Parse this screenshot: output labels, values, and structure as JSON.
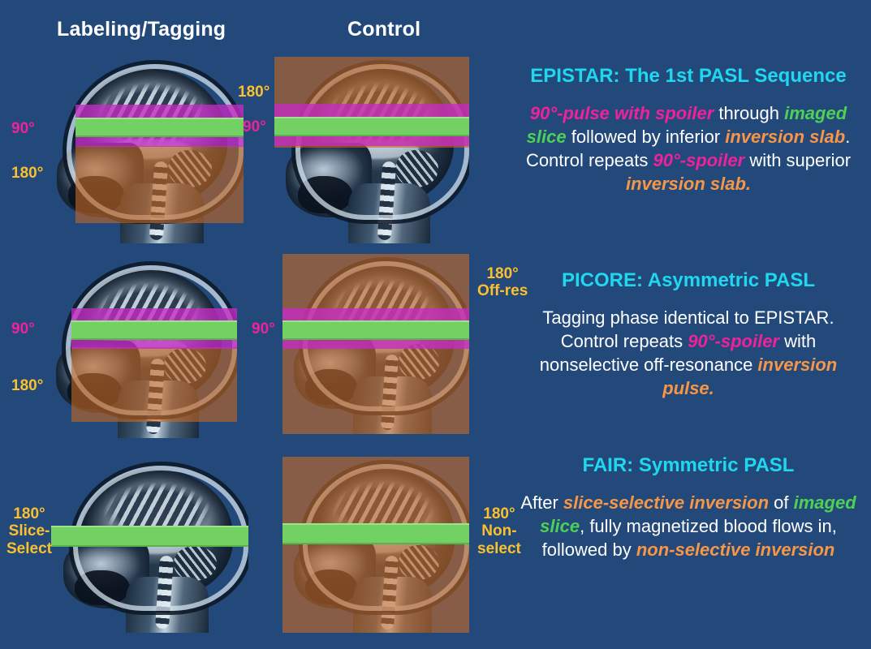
{
  "palette": {
    "background": "#23497b",
    "title_cyan": "#1fd7ee",
    "pink": "#f0219b",
    "green": "#4ed054",
    "orange": "#f79646",
    "yellow": "#fbc02d",
    "white": "#ffffff",
    "band_magenta": "#c62ac4",
    "band_green": "#72d162",
    "inversion_orange": "#c46b26"
  },
  "headers": {
    "labeling": "Labeling/Tagging",
    "control": "Control"
  },
  "rows": [
    {
      "id": "epistar",
      "title": "EPISTAR: The 1st PASL Sequence",
      "tagging_annotations": [
        {
          "id": "tag-90",
          "text": "90°",
          "color": "pink"
        },
        {
          "id": "tag-180",
          "text": "180°",
          "color": "yellow"
        }
      ],
      "control_annotations": [
        {
          "id": "ctl-180",
          "text": "180°",
          "color": "yellow"
        },
        {
          "id": "ctl-90",
          "text": "90°",
          "color": "pink"
        }
      ],
      "description": {
        "segments": [
          {
            "text": "90°-pulse with spoiler",
            "style": "pink"
          },
          {
            "text": " through ",
            "style": "plain"
          },
          {
            "text": "imaged slice",
            "style": "green"
          },
          {
            "text": " followed by inferior ",
            "style": "plain"
          },
          {
            "text": "inversion slab",
            "style": "orange"
          },
          {
            "text": ". Control repeats ",
            "style": "plain"
          },
          {
            "text": "90°-spoiler",
            "style": "pink"
          },
          {
            "text": " with superior ",
            "style": "plain"
          },
          {
            "text": "inversion slab.",
            "style": "orange"
          }
        ]
      }
    },
    {
      "id": "picore",
      "title": "PICORE: Asymmetric PASL",
      "tagging_annotations": [
        {
          "id": "tag-90",
          "text": "90°",
          "color": "pink"
        },
        {
          "id": "tag-180",
          "text": "180°",
          "color": "yellow"
        }
      ],
      "control_annotations": [
        {
          "id": "ctl-180-offres",
          "text": "180°\nOff-res",
          "color": "yellow"
        },
        {
          "id": "ctl-90",
          "text": "90°",
          "color": "pink"
        }
      ],
      "description": {
        "segments": [
          {
            "text": "Tagging phase identical to EPISTAR. Control repeats ",
            "style": "plain"
          },
          {
            "text": "90°-spoiler",
            "style": "pink"
          },
          {
            "text": " with nonselective off-resonance ",
            "style": "plain"
          },
          {
            "text": "inversion pulse.",
            "style": "orange"
          }
        ]
      }
    },
    {
      "id": "fair",
      "title": "FAIR: Symmetric PASL",
      "tagging_annotations": [
        {
          "id": "tag-180-sliceselect",
          "text": "180°\nSlice-\nSelect",
          "color": "yellow"
        }
      ],
      "control_annotations": [
        {
          "id": "ctl-180-nonselect",
          "text": "180°\nNon-\nselect",
          "color": "yellow"
        }
      ],
      "description": {
        "segments": [
          {
            "text": "After ",
            "style": "plain"
          },
          {
            "text": "slice-selective inversion",
            "style": "orange"
          },
          {
            "text": " of ",
            "style": "plain"
          },
          {
            "text": "imaged slice",
            "style": "green"
          },
          {
            "text": ", fully magnetized blood flows in, followed by ",
            "style": "plain"
          },
          {
            "text": "non-selective inversion",
            "style": "orange"
          }
        ]
      }
    }
  ]
}
